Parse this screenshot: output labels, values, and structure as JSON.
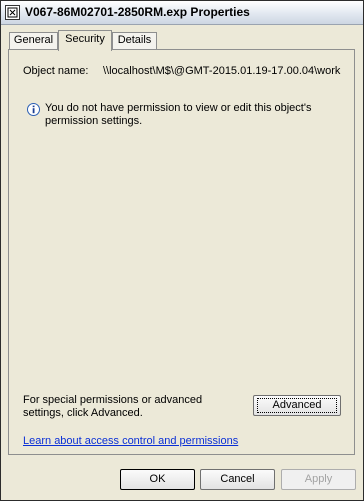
{
  "window": {
    "title": "V067-86M02701-2850RM.exp Properties",
    "icon": "file-properties-icon"
  },
  "tabs": [
    {
      "label": "General",
      "active": false
    },
    {
      "label": "Security",
      "active": true
    },
    {
      "label": "Details",
      "active": false
    }
  ],
  "security": {
    "object_name_label": "Object name:",
    "object_name_value": "\\\\localhost\\M$\\@GMT-2015.01.19-17.00.04\\work",
    "info_icon": "info-icon",
    "permission_message": "You do not have permission to view or edit this object's permission settings.",
    "advanced_hint": "For special permissions or advanced settings, click Advanced.",
    "advanced_button": "Advanced",
    "learn_link": "Learn about access control and permissions"
  },
  "buttons": {
    "ok": "OK",
    "cancel": "Cancel",
    "apply": "Apply"
  }
}
